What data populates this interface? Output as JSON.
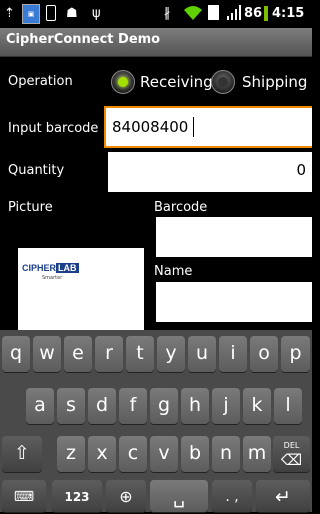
{
  "status": {
    "battery_level": "86",
    "time": "4:15",
    "icons": [
      "upload-icon",
      "cipherlab-app-icon",
      "phone-icon",
      "android-icon",
      "usb-icon",
      "bluetooth-icon",
      "wifi-icon",
      "sim-icon",
      "signal-icon"
    ]
  },
  "app": {
    "title": "CipherConnect Demo"
  },
  "form": {
    "operation_label": "Operation",
    "options": [
      "Receiving",
      "Shipping"
    ],
    "selected_option": "Receiving",
    "input_barcode_label": "Input barcode",
    "input_barcode_value": "84008400",
    "quantity_label": "Quantity",
    "quantity_value": "0",
    "picture_label": "Picture",
    "barcode_label": "Barcode",
    "barcode_value": "",
    "name_label": "Name",
    "name_value": ""
  },
  "logo": {
    "text_cipher": "CIPHER",
    "text_lab": "LAB",
    "tagline": "Smarter"
  },
  "keyboard": {
    "row1": [
      "q",
      "w",
      "e",
      "r",
      "t",
      "y",
      "u",
      "i",
      "o",
      "p"
    ],
    "row2": [
      "a",
      "s",
      "d",
      "f",
      "g",
      "h",
      "j",
      "k",
      "l"
    ],
    "row3": [
      "z",
      "x",
      "c",
      "v",
      "b",
      "n",
      "m"
    ],
    "del_label": "DEL",
    "numbers_label": "123",
    "period_comma": ". ,"
  },
  "colors": {
    "accent_green": "#a4e000",
    "field_focus": "#f08a00"
  }
}
